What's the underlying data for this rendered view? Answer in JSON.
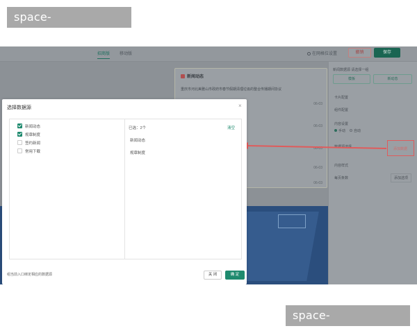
{
  "watermark": {
    "text": "space-bbsports.com"
  },
  "background": {
    "tabs": [
      "招商版",
      "移动版"
    ],
    "preview_label": "在网格位设置",
    "btn_red": "撤销",
    "btn_green": "保存",
    "card": {
      "title": "新闻动态",
      "text": "重庆市河北美雅山市政府市春节假期清理垃圾的整合传播期间协议",
      "dates": [
        "06-03",
        "06-03",
        "06-03",
        "06-03",
        "06-03"
      ]
    },
    "right_panel": {
      "title": "新闻数据源 请选择一组",
      "seg_a": "模板",
      "seg_b": "新动态",
      "rows": [
        "卡片配置",
        "组件配置",
        "内容设置",
        "数据源选择",
        "内容样式",
        "每页条数"
      ],
      "radio_a": "手动",
      "radio_b": "自动",
      "highlight_label": "添加数据",
      "right_btn": "添加选项"
    }
  },
  "modal": {
    "title": "选择数据源",
    "close_glyph": "×",
    "left_items": [
      {
        "label": "新闻动态",
        "checked": true
      },
      {
        "label": "规章制度",
        "checked": true
      },
      {
        "label": "签约新闻",
        "checked": false
      },
      {
        "label": "常用下载",
        "checked": false
      }
    ],
    "selected_count_label": "已选：2个",
    "clear_label": "清空",
    "selected_items": [
      "新闻动态",
      "规章制度"
    ],
    "hint": "组当前入口绑定相应的数据源",
    "close_button": "关 闭",
    "ok_button": "确 定"
  },
  "colors": {
    "accent": "#1e8a6e",
    "highlight": "#e05b5b"
  }
}
